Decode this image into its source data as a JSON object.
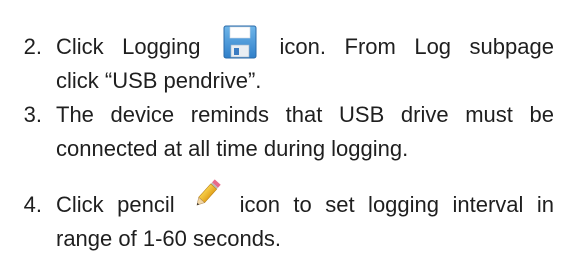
{
  "steps": [
    {
      "number": "2.",
      "line1_before": "Click Logging",
      "line1_after": "icon. From Log subpage",
      "line2": "click “USB pendrive”.",
      "icon": "floppy-disk-icon"
    },
    {
      "number": "3.",
      "line1": "The device reminds that USB drive must be",
      "line2": "connected at all time during logging."
    },
    {
      "number": "4.",
      "line1_before": "Click pencil",
      "line1_after": "icon to set logging interval in",
      "line2": "range of 1-60 seconds.",
      "icon": "pencil-icon"
    }
  ]
}
